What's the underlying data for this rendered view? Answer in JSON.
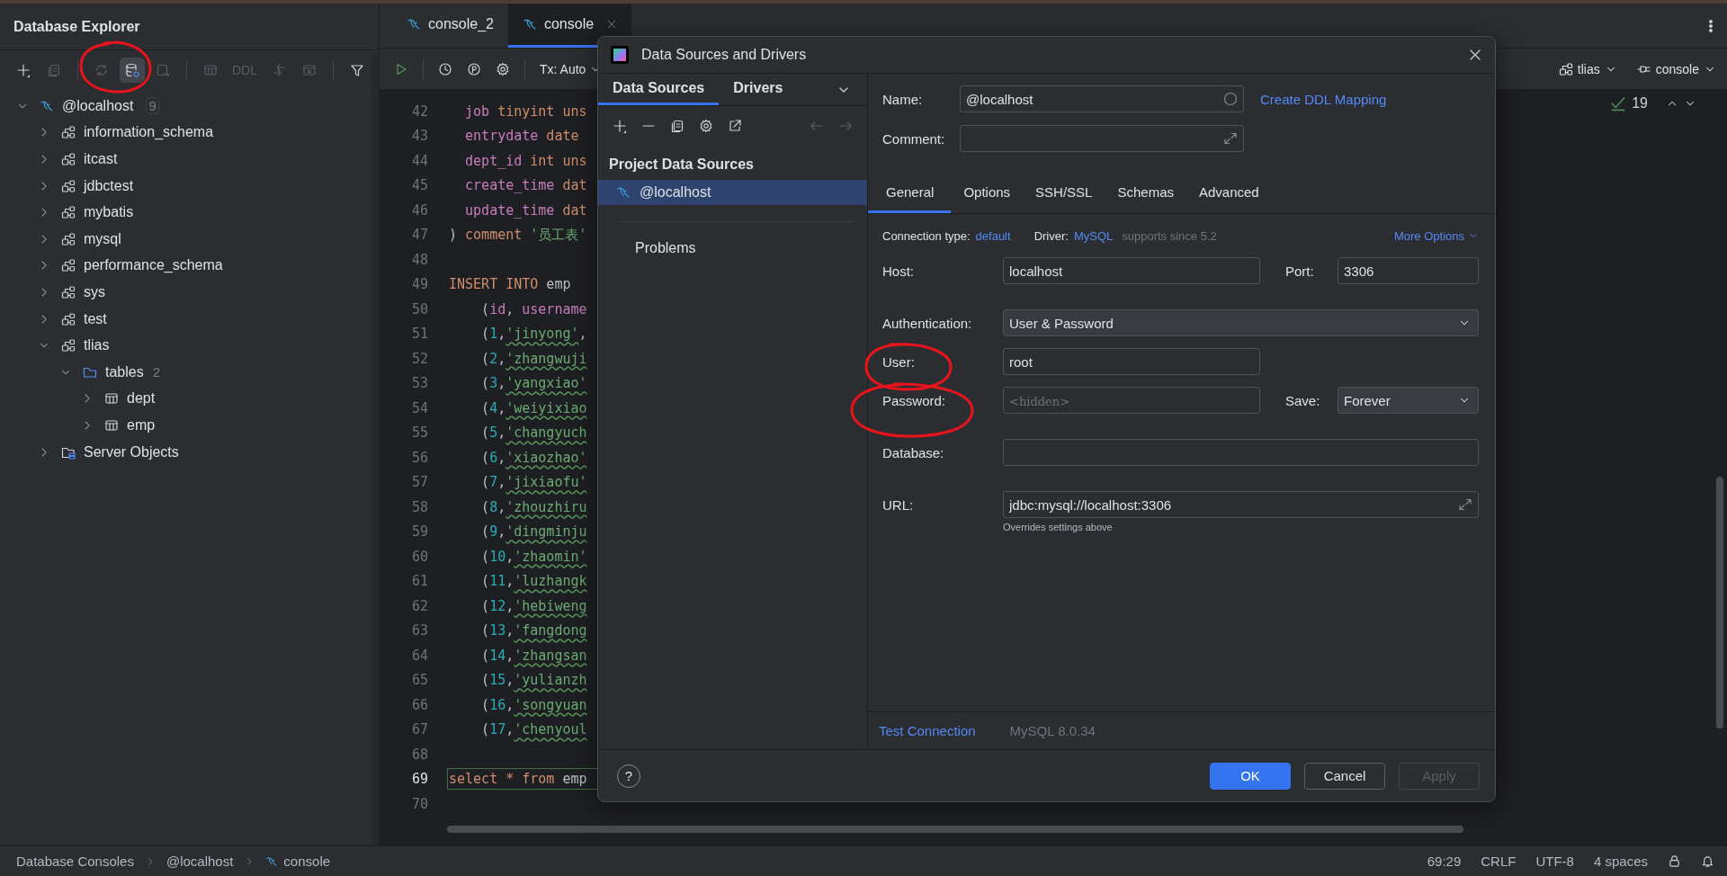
{
  "explorer": {
    "title": "Database Explorer",
    "toolbar": [
      {
        "kind": "icon",
        "disabled": false,
        "active": false
      },
      {
        "kind": "icon",
        "disabled": true,
        "active": false
      },
      {
        "kind": "separator"
      },
      {
        "kind": "icon",
        "disabled": true,
        "active": false
      },
      {
        "kind": "icon",
        "disabled": false,
        "active": true
      },
      {
        "kind": "icon",
        "disabled": true,
        "active": false
      },
      {
        "kind": "separator"
      },
      {
        "kind": "icon",
        "disabled": true,
        "active": false
      },
      {
        "kind": "text",
        "label": "DDL",
        "disabled": true,
        "active": false
      },
      {
        "kind": "icon",
        "disabled": true,
        "active": false
      },
      {
        "kind": "icon",
        "disabled": true,
        "active": false
      },
      {
        "kind": "separator"
      },
      {
        "kind": "icon",
        "disabled": false,
        "active": false
      }
    ],
    "tree": [
      {
        "label": "@localhost",
        "kind": "server",
        "count": "9",
        "expanded": true,
        "children": [
          {
            "label": "information_schema",
            "kind": "schema",
            "expanded": false
          },
          {
            "label": "itcast",
            "kind": "schema",
            "expanded": false
          },
          {
            "label": "jdbctest",
            "kind": "schema",
            "expanded": false
          },
          {
            "label": "mybatis",
            "kind": "schema",
            "expanded": false
          },
          {
            "label": "mysql",
            "kind": "schema",
            "expanded": false
          },
          {
            "label": "performance_schema",
            "kind": "schema",
            "expanded": false
          },
          {
            "label": "sys",
            "kind": "schema",
            "expanded": false
          },
          {
            "label": "test",
            "kind": "schema",
            "expanded": false
          },
          {
            "label": "tlias",
            "kind": "schema",
            "expanded": true,
            "children": [
              {
                "label": "tables",
                "kind": "folder",
                "count": "2",
                "expanded": true,
                "children": [
                  {
                    "label": "dept",
                    "kind": "table",
                    "expanded": false
                  },
                  {
                    "label": "emp",
                    "kind": "table",
                    "expanded": false
                  }
                ]
              }
            ]
          },
          {
            "label": "Server Objects",
            "kind": "objects",
            "expanded": false
          }
        ]
      }
    ]
  },
  "editor": {
    "tabs": [
      {
        "label": "console_2",
        "selected": false,
        "closable": false
      },
      {
        "label": "console",
        "selected": true,
        "closable": true
      }
    ],
    "tx": "Tx: Auto",
    "schema": "tlias",
    "session": "console",
    "inspections": "19",
    "lines": [
      {
        "number": "42",
        "current": false,
        "tokens": [
          {
            "kind": "field",
            "text": "  job"
          },
          {
            "kind": "keyword",
            "text": " tinyint uns"
          }
        ]
      },
      {
        "number": "43",
        "current": false,
        "tokens": [
          {
            "kind": "field",
            "text": "  entrydate"
          },
          {
            "kind": "keyword",
            "text": " date"
          }
        ]
      },
      {
        "number": "44",
        "current": false,
        "tokens": [
          {
            "kind": "field",
            "text": "  dept_id"
          },
          {
            "kind": "keyword",
            "text": " int uns"
          }
        ]
      },
      {
        "number": "45",
        "current": false,
        "tokens": [
          {
            "kind": "field",
            "text": "  create_time"
          },
          {
            "kind": "keyword",
            "text": " dat"
          }
        ]
      },
      {
        "number": "46",
        "current": false,
        "tokens": [
          {
            "kind": "field",
            "text": "  update_time"
          },
          {
            "kind": "keyword",
            "text": " dat"
          }
        ]
      },
      {
        "number": "47",
        "current": false,
        "tokens": [
          {
            "kind": "plain",
            "text": ") "
          },
          {
            "kind": "keyword",
            "text": "comment "
          },
          {
            "kind": "string",
            "text": "'员工表'"
          }
        ]
      },
      {
        "number": "48",
        "current": false
      },
      {
        "number": "49",
        "current": false,
        "tokens": [
          {
            "kind": "keyword",
            "text": "INSERT INTO"
          },
          {
            "kind": "plain",
            "text": " emp"
          }
        ]
      },
      {
        "number": "50",
        "current": false,
        "tokens": [
          {
            "kind": "plain",
            "text": "    ("
          },
          {
            "kind": "field",
            "text": "id"
          },
          {
            "kind": "plain",
            "text": ", "
          },
          {
            "kind": "field",
            "text": "username"
          }
        ]
      },
      {
        "number": "51",
        "current": false,
        "tokens": [
          {
            "kind": "plain",
            "text": "    ("
          },
          {
            "kind": "number",
            "text": "1"
          },
          {
            "kind": "plain",
            "text": ","
          },
          {
            "kind": "misspelt",
            "text": "'jinyong'"
          },
          {
            "kind": "plain",
            "text": ","
          }
        ]
      },
      {
        "number": "52",
        "current": false,
        "tokens": [
          {
            "kind": "plain",
            "text": "    ("
          },
          {
            "kind": "number",
            "text": "2"
          },
          {
            "kind": "plain",
            "text": ","
          },
          {
            "kind": "misspelt",
            "text": "'zhangwuji"
          }
        ]
      },
      {
        "number": "53",
        "current": false,
        "tokens": [
          {
            "kind": "plain",
            "text": "    ("
          },
          {
            "kind": "number",
            "text": "3"
          },
          {
            "kind": "plain",
            "text": ","
          },
          {
            "kind": "misspelt",
            "text": "'yangxiao'"
          }
        ]
      },
      {
        "number": "54",
        "current": false,
        "tokens": [
          {
            "kind": "plain",
            "text": "    ("
          },
          {
            "kind": "number",
            "text": "4"
          },
          {
            "kind": "plain",
            "text": ","
          },
          {
            "kind": "misspelt",
            "text": "'weiyixiao"
          }
        ]
      },
      {
        "number": "55",
        "current": false,
        "tokens": [
          {
            "kind": "plain",
            "text": "    ("
          },
          {
            "kind": "number",
            "text": "5"
          },
          {
            "kind": "plain",
            "text": ","
          },
          {
            "kind": "misspelt",
            "text": "'changyuch"
          }
        ]
      },
      {
        "number": "56",
        "current": false,
        "tokens": [
          {
            "kind": "plain",
            "text": "    ("
          },
          {
            "kind": "number",
            "text": "6"
          },
          {
            "kind": "plain",
            "text": ","
          },
          {
            "kind": "misspelt",
            "text": "'xiaozhao'"
          }
        ]
      },
      {
        "number": "57",
        "current": false,
        "tokens": [
          {
            "kind": "plain",
            "text": "    ("
          },
          {
            "kind": "number",
            "text": "7"
          },
          {
            "kind": "plain",
            "text": ","
          },
          {
            "kind": "misspelt",
            "text": "'jixiaofu'"
          }
        ]
      },
      {
        "number": "58",
        "current": false,
        "tokens": [
          {
            "kind": "plain",
            "text": "    ("
          },
          {
            "kind": "number",
            "text": "8"
          },
          {
            "kind": "plain",
            "text": ","
          },
          {
            "kind": "misspelt",
            "text": "'zhouzhiru"
          }
        ]
      },
      {
        "number": "59",
        "current": false,
        "tokens": [
          {
            "kind": "plain",
            "text": "    ("
          },
          {
            "kind": "number",
            "text": "9"
          },
          {
            "kind": "plain",
            "text": ","
          },
          {
            "kind": "misspelt",
            "text": "'dingminju"
          }
        ]
      },
      {
        "number": "60",
        "current": false,
        "tokens": [
          {
            "kind": "plain",
            "text": "    ("
          },
          {
            "kind": "number",
            "text": "10"
          },
          {
            "kind": "plain",
            "text": ","
          },
          {
            "kind": "misspelt",
            "text": "'zhaomin'"
          }
        ]
      },
      {
        "number": "61",
        "current": false,
        "tokens": [
          {
            "kind": "plain",
            "text": "    ("
          },
          {
            "kind": "number",
            "text": "11"
          },
          {
            "kind": "plain",
            "text": ","
          },
          {
            "kind": "misspelt",
            "text": "'luzhangk"
          }
        ]
      },
      {
        "number": "62",
        "current": false,
        "tokens": [
          {
            "kind": "plain",
            "text": "    ("
          },
          {
            "kind": "number",
            "text": "12"
          },
          {
            "kind": "plain",
            "text": ","
          },
          {
            "kind": "misspelt",
            "text": "'hebiweng"
          }
        ]
      },
      {
        "number": "63",
        "current": false,
        "tokens": [
          {
            "kind": "plain",
            "text": "    ("
          },
          {
            "kind": "number",
            "text": "13"
          },
          {
            "kind": "plain",
            "text": ","
          },
          {
            "kind": "misspelt",
            "text": "'fangdong"
          }
        ]
      },
      {
        "number": "64",
        "current": false,
        "tokens": [
          {
            "kind": "plain",
            "text": "    ("
          },
          {
            "kind": "number",
            "text": "14"
          },
          {
            "kind": "plain",
            "text": ","
          },
          {
            "kind": "misspelt",
            "text": "'zhangsan"
          }
        ]
      },
      {
        "number": "65",
        "current": false,
        "tokens": [
          {
            "kind": "plain",
            "text": "    ("
          },
          {
            "kind": "number",
            "text": "15"
          },
          {
            "kind": "plain",
            "text": ","
          },
          {
            "kind": "misspelt",
            "text": "'yulianzh"
          }
        ]
      },
      {
        "number": "66",
        "current": false,
        "tokens": [
          {
            "kind": "plain",
            "text": "    ("
          },
          {
            "kind": "number",
            "text": "16"
          },
          {
            "kind": "plain",
            "text": ","
          },
          {
            "kind": "misspelt",
            "text": "'songyuan"
          }
        ]
      },
      {
        "number": "67",
        "current": false,
        "tokens": [
          {
            "kind": "plain",
            "text": "    ("
          },
          {
            "kind": "number",
            "text": "17"
          },
          {
            "kind": "plain",
            "text": ","
          },
          {
            "kind": "misspelt",
            "text": "'chenyoul"
          }
        ]
      },
      {
        "number": "68",
        "current": false
      },
      {
        "number": "69",
        "current": true,
        "tokens": [
          {
            "kind": "keyword",
            "text": "select"
          },
          {
            "kind": "op",
            "text": " * "
          },
          {
            "kind": "keyword",
            "text": "from"
          },
          {
            "kind": "plain",
            "text": " emp"
          }
        ]
      },
      {
        "number": "70",
        "current": false
      }
    ]
  },
  "dialog": {
    "title": "Data Sources and Drivers",
    "left_tabs": [
      {
        "label": "Data Sources",
        "selected": true
      },
      {
        "label": "Drivers",
        "selected": false
      }
    ],
    "section": "Project Data Sources",
    "sources": [
      {
        "label": "@localhost",
        "selected": true
      }
    ],
    "problems": "Problems",
    "name": {
      "label": "Name:",
      "value": "@localhost"
    },
    "ddl_link": "Create DDL Mapping",
    "comment": {
      "label": "Comment:"
    },
    "tabs": [
      {
        "label": "General",
        "selected": true
      },
      {
        "label": "Options",
        "selected": false
      },
      {
        "label": "SSH/SSL",
        "selected": false
      },
      {
        "label": "Schemas",
        "selected": false
      },
      {
        "label": "Advanced",
        "selected": false
      }
    ],
    "connection": {
      "type_label": "Connection type:",
      "type": "default",
      "driver_label": "Driver:",
      "driver": "MySQL",
      "driver_note": "supports since 5.2",
      "more": "More Options"
    },
    "host": {
      "label": "Host:",
      "value": "localhost"
    },
    "port": {
      "label": "Port:",
      "value": "3306"
    },
    "auth": {
      "label": "Authentication:",
      "value": "User & Password"
    },
    "user": {
      "label": "User:",
      "value": "root"
    },
    "password": {
      "label": "Password:",
      "placeholder": "<hidden>"
    },
    "save": {
      "label": "Save:",
      "value": "Forever"
    },
    "database": {
      "label": "Database:"
    },
    "url": {
      "label": "URL:",
      "value": "jdbc:mysql://localhost:3306",
      "hint": "Overrides settings above"
    },
    "test": "Test Connection",
    "version": "MySQL 8.0.34",
    "help": "?",
    "buttons": [
      {
        "label": "OK",
        "kind": "primary",
        "disabled": false
      },
      {
        "label": "Cancel",
        "kind": "normal",
        "disabled": false
      },
      {
        "label": "Apply",
        "kind": "normal",
        "disabled": true
      }
    ]
  },
  "status_bar": {
    "breadcrumbs": [
      {
        "label": "Database Consoles",
        "kind": "plain"
      },
      {
        "label": "@localhost",
        "kind": "plain"
      },
      {
        "label": "console",
        "kind": "console"
      }
    ],
    "items": [
      "69:29",
      "CRLF",
      "UTF-8",
      "4 spaces"
    ]
  }
}
